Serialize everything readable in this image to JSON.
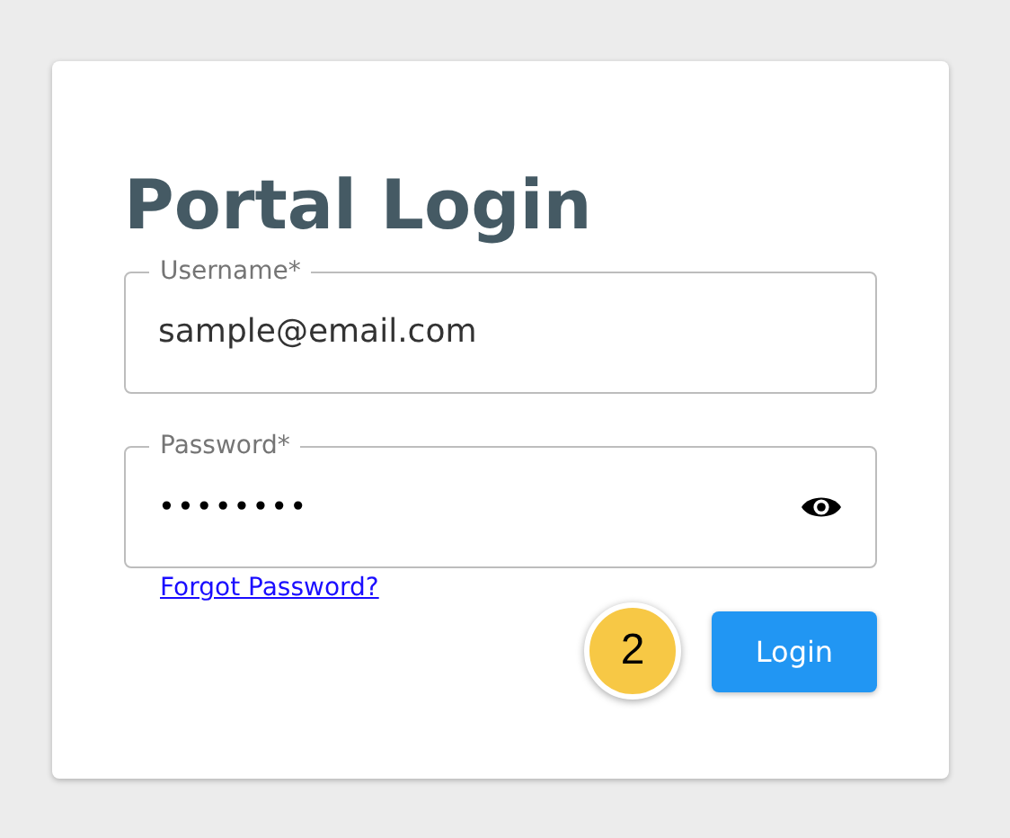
{
  "title": "Portal Login",
  "fields": [
    {
      "label": "Username*",
      "value": "sample@email.com",
      "kind": "text"
    },
    {
      "label": "Password*",
      "value": "••••••••",
      "kind": "password"
    }
  ],
  "forgot_link": "Forgot Password?",
  "step_badge": "2",
  "login_button": "Login"
}
